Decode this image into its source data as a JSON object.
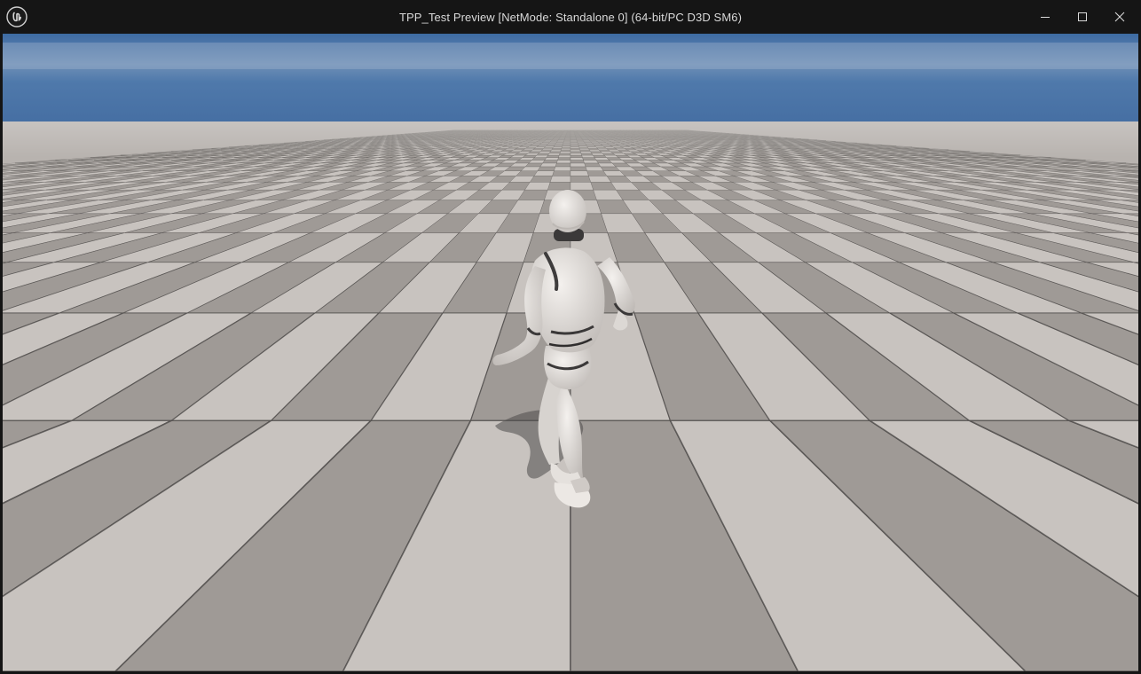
{
  "window": {
    "title": "TPP_Test Preview [NetMode: Standalone 0]  (64-bit/PC D3D SM6)",
    "logo_icon": "unreal-engine-logo-icon",
    "controls": {
      "minimize_icon": "minimize-icon",
      "maximize_icon": "maximize-icon",
      "close_icon": "close-icon"
    }
  },
  "viewport": {
    "scene": "third-person-character-on-grid-floor",
    "colors": {
      "sky_top": "#3f6fa8",
      "sky_bottom": "#4a79ad",
      "floor_light": "#c8c3bf",
      "floor_dark": "#9f9a96",
      "grid_line": "#4e4b4a"
    }
  }
}
